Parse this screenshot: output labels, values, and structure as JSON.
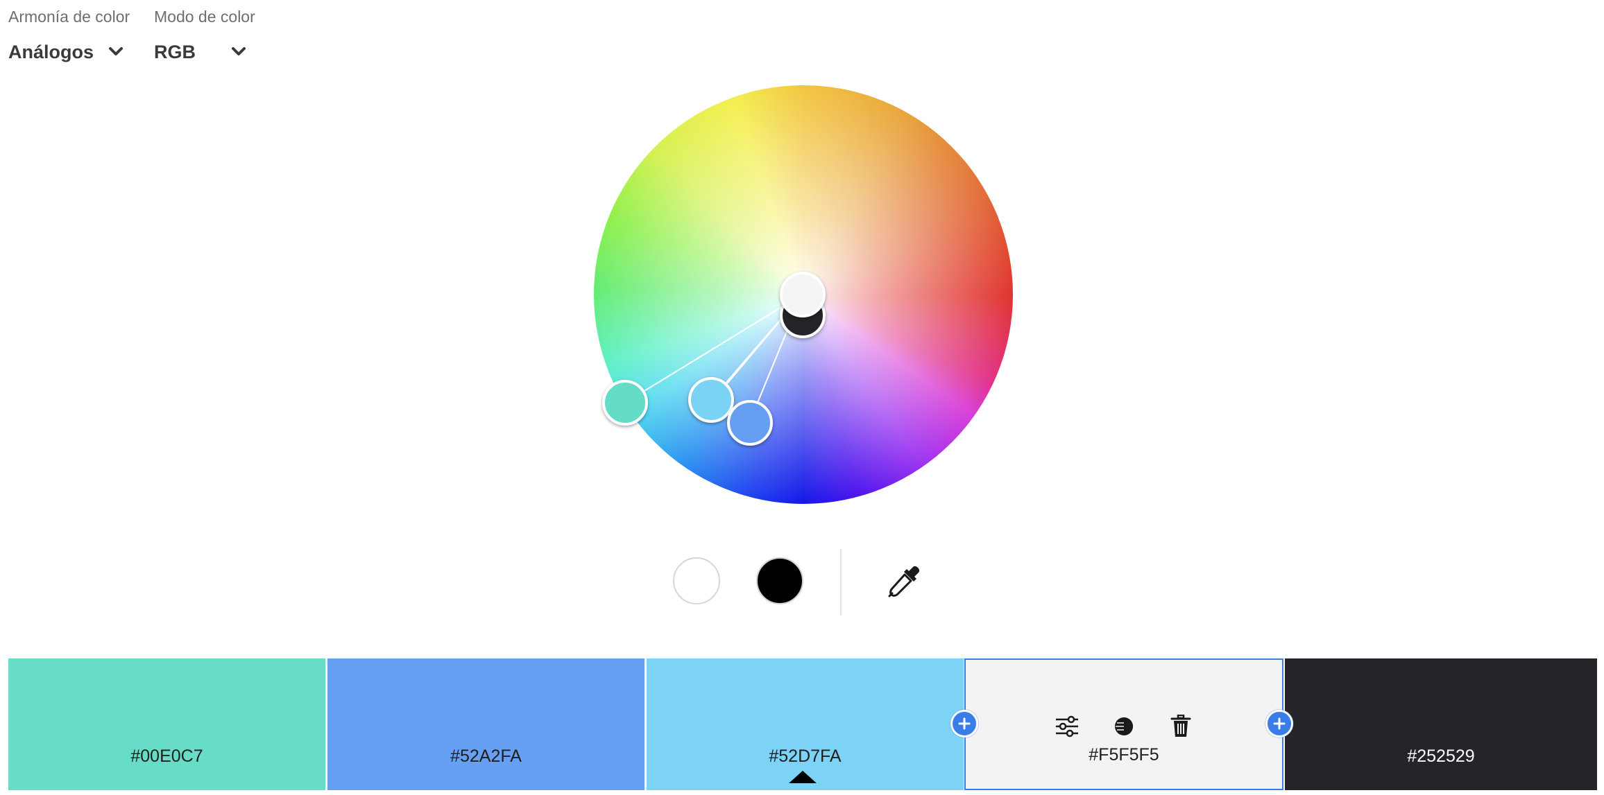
{
  "controls": {
    "harmony": {
      "label": "Armonía de color",
      "value": "Análogos"
    },
    "mode": {
      "label": "Modo de color",
      "value": "RGB"
    }
  },
  "wheel": {
    "handles": [
      {
        "name": "handle-teal",
        "color": "#63DDC6"
      },
      {
        "name": "handle-light-blue",
        "color": "#7AD2F4"
      },
      {
        "name": "handle-blue",
        "color": "#669FF2"
      },
      {
        "name": "handle-dark",
        "color": "#252529"
      },
      {
        "name": "handle-light",
        "color": "#F5F5F5"
      }
    ]
  },
  "tools": {
    "white_swatch": "#FFFFFF",
    "black_swatch": "#000000",
    "eyedropper_icon": "eyedropper-icon"
  },
  "palette": {
    "swatches": [
      {
        "hex": "#00E0C7",
        "fill": "#67DDC7"
      },
      {
        "hex": "#52A2FA",
        "fill": "#67A0F2"
      },
      {
        "hex": "#52D7FA",
        "fill": "#7CD3F5"
      },
      {
        "hex": "#F5F5F5",
        "fill": "#F4F3F4"
      },
      {
        "hex": "#252529",
        "fill": "#252529"
      }
    ],
    "swatch_tool_icons": [
      "sliders-icon",
      "contrast-icon",
      "trash-icon"
    ],
    "accent": "#3B7DE8"
  }
}
